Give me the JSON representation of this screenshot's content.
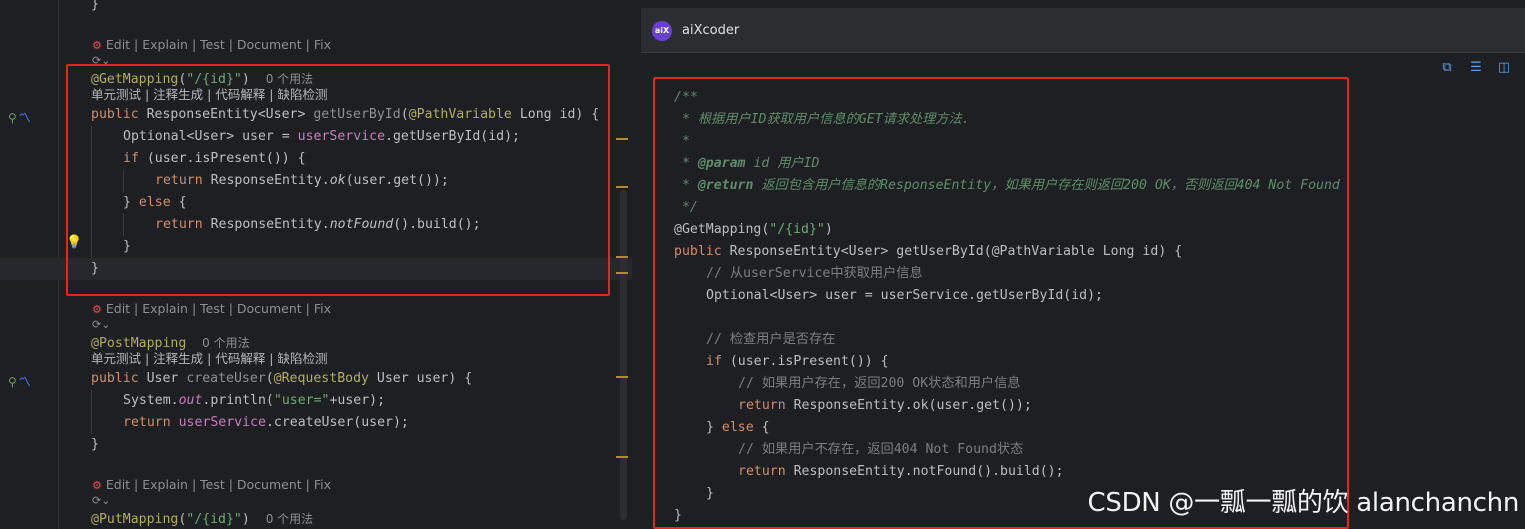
{
  "editor": {
    "code_lens": "Edit | Explain | Test | Document | Fix",
    "cn_lens": "单元测试 | 注释生成 | 代码解释 | 缺陷检测",
    "usages": "0 个用法",
    "method1": {
      "annotation": "@GetMapping",
      "annotation_arg": "\"/{id}\"",
      "sig_public": "public",
      "sig_type": "ResponseEntity<User>",
      "sig_name": "getUserById",
      "sig_param_ann": "@PathVariable",
      "sig_param": "Long id",
      "l1_a": "Optional<User> user = ",
      "l1_field": "userService",
      "l1_b": ".getUserById(id);",
      "l2_kw": "if",
      "l2_text": " (user.isPresent()) {",
      "l3_kw": "return",
      "l3_a": " ResponseEntity.",
      "l3_it": "ok",
      "l3_b": "(user.get());",
      "l4_a": "} ",
      "l4_kw": "else",
      "l4_b": " {",
      "l5_kw": "return",
      "l5_a": " ResponseEntity.",
      "l5_it": "notFound",
      "l5_b": "().build();",
      "close_inner": "}",
      "close_outer": "}"
    },
    "method2": {
      "annotation": "@PostMapping",
      "sig_public": "public",
      "sig_type": "User",
      "sig_name": "createUser",
      "sig_param_ann": "@RequestBody",
      "sig_param": "User user",
      "l1_a": "System.",
      "l1_it": "out",
      "l1_b": ".println(",
      "l1_str": "\"user=\"",
      "l1_c": "+user);",
      "l2_kw": "return",
      "l2_field": "userService",
      "l2_b": ".createUser(user);",
      "close": "}"
    },
    "method3": {
      "annotation": "@PutMapping",
      "annotation_arg": "\"/{id}\""
    },
    "top_brace": "}"
  },
  "panel": {
    "title": "aiXcoder",
    "logo": "aiX",
    "toolbar_icons": [
      "copy-icon",
      "insert-icon",
      "split-view-icon"
    ],
    "code": {
      "d1": "/**",
      "d2": " * 根据用户ID获取用户信息的GET请求处理方法.",
      "d3": " *",
      "d4_tag": "@param",
      "d4_text": " id 用户ID",
      "d5_tag": "@return",
      "d5_text": " 返回包含用户信息的ResponseEntity，如果用户存在则返回200 OK，否则返回404 Not Found",
      "d6": " */",
      "ann": "@GetMapping(",
      "ann_str": "\"/{id}\"",
      "ann_end": ")",
      "sig_kw": "public",
      "sig": " ResponseEntity<User> getUserById(@PathVariable Long id) {",
      "c1": "// 从userService中获取用户信息",
      "s1": "Optional<User> user = userService.getUserById(id);",
      "c2": "// 检查用户是否存在",
      "if_kw": "if",
      "if_text": " (user.isPresent()) {",
      "c3": "// 如果用户存在，返回200 OK状态和用户信息",
      "ret1_kw": "return",
      "ret1": " ResponseEntity.ok(user.get());",
      "else_a": "} ",
      "else_kw": "else",
      "else_b": " {",
      "c4": "// 如果用户不存在，返回404 Not Found状态",
      "ret2_kw": "return",
      "ret2": " ResponseEntity.notFound().build();",
      "close1": "}",
      "close2": "}"
    }
  },
  "watermark": "CSDN @一瓢一瓢的饮 alanchanchn"
}
